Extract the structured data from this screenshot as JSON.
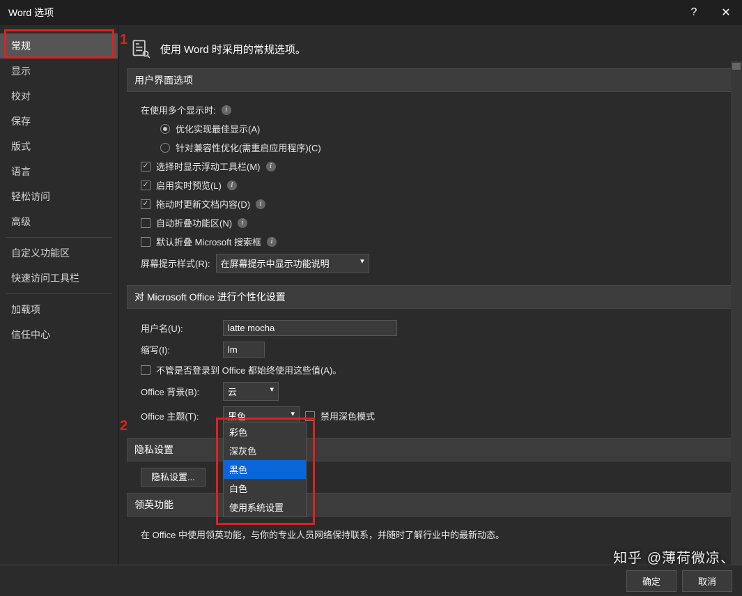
{
  "title": "Word 选项",
  "sidebar": {
    "items": [
      "常规",
      "显示",
      "校对",
      "保存",
      "版式",
      "语言",
      "轻松访问",
      "高级"
    ],
    "items2": [
      "自定义功能区",
      "快速访问工具栏"
    ],
    "items3": [
      "加载项",
      "信任中心"
    ],
    "active_index": 0
  },
  "annotations": {
    "n1": "1",
    "n2": "2"
  },
  "header": {
    "text": "使用 Word 时采用的常规选项。"
  },
  "sections": {
    "ui": {
      "title": "用户界面选项",
      "multi_display_label": "在使用多个显示时:",
      "opt_best": "优化实现最佳显示(A)",
      "opt_compat": "针对兼容性优化(需重启应用程序)(C)",
      "chk_minibar": "选择时显示浮动工具栏(M)",
      "chk_livepreview": "启用实时预览(L)",
      "chk_dragupdate": "拖动时更新文档内容(D)",
      "chk_collapse": "自动折叠功能区(N)",
      "chk_mssearch": "默认折叠 Microsoft 搜索框",
      "tip_label": "屏幕提示样式(R):",
      "tip_value": "在屏幕提示中显示功能说明"
    },
    "personal": {
      "title": "对 Microsoft Office 进行个性化设置",
      "username_label": "用户名(U):",
      "username_value": "latte mocha",
      "initials_label": "缩写(I):",
      "initials_value": "lm",
      "always_label": "不管是否登录到 Office 都始终使用这些值(A)。",
      "bg_label": "Office 背景(B):",
      "bg_value": "云",
      "theme_label": "Office 主题(T):",
      "theme_value": "黑色",
      "theme_options": [
        "彩色",
        "深灰色",
        "黑色",
        "白色",
        "使用系统设置"
      ],
      "disable_dark": "禁用深色模式"
    },
    "privacy": {
      "title": "隐私设置",
      "btn": "隐私设置..."
    },
    "linkedin": {
      "title": "领英功能",
      "desc": "在 Office 中使用领英功能，与你的专业人员网络保持联系，并随时了解行业中的最新动态。"
    }
  },
  "footer": {
    "ok": "确定",
    "cancel": "取消"
  },
  "watermark": "知乎 @薄荷微凉、"
}
